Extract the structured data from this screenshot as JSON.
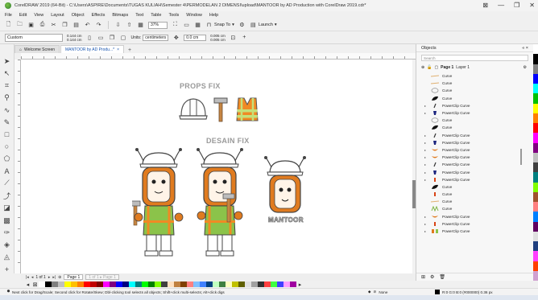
{
  "window": {
    "title": "CorelDRAW 2019 (64-Bit) - C:\\Users\\ASPIRE\\Documents\\TUGAS KULIAH\\Semester 4\\PERMODELAN 2 DIMENSI\\upload\\MANTOOR by AD Production with CorelDraw 2019.cdr*",
    "controls": [
      "⊠",
      "—",
      "❐",
      "✕"
    ]
  },
  "menu": [
    "File",
    "Edit",
    "View",
    "Layout",
    "Object",
    "Effects",
    "Bitmaps",
    "Text",
    "Table",
    "Tools",
    "Window",
    "Help"
  ],
  "toolbar": {
    "zoom": "37%",
    "snap_to": "Snap To",
    "launch": "Launch"
  },
  "property_bar": {
    "page_preset": "Custom",
    "width": "0.144 cm",
    "height": "0.144 cm",
    "units_label": "Units:",
    "units": "centimeters",
    "nudge": "0.0 cm",
    "dup_x": "0.005 cm",
    "dup_y": "0.005 cm"
  },
  "tabs": [
    {
      "label": "Welcome Screen",
      "active": false
    },
    {
      "label": "MANTOOR by AD Produ...*",
      "active": true
    }
  ],
  "canvas": {
    "props_heading": "PROPS FIX",
    "desain_heading": "DESAIN FIX",
    "mascot_label": "MANTOOR"
  },
  "page_navigator": {
    "counter": "1 of 1",
    "page": "Page 1",
    "ghost_page": "1 of 1 ▸ Page 1"
  },
  "status": {
    "hint": "Next click for Drag/Scale; Second click for Rotate/Skew; Dbl-clicking tool selects all objects; Shift+click multi-selects; Alt+click digs",
    "fill": "None",
    "fill_info": "R:0 G:0 B:0 (#000000) 0.36 px"
  },
  "docker": {
    "title": "Objects",
    "search_placeholder": "Search",
    "page_label": "Page 1",
    "layer_label": "Layer 1",
    "objects": [
      {
        "label": "Curve",
        "expandable": false,
        "thumb": "line"
      },
      {
        "label": "Curve",
        "expandable": false,
        "thumb": "line"
      },
      {
        "label": "Curve",
        "expandable": false,
        "thumb": "ring"
      },
      {
        "label": "Curve",
        "expandable": false,
        "thumb": "black"
      },
      {
        "label": "PowerClip Curve",
        "expandable": true,
        "thumb": "slash"
      },
      {
        "label": "PowerClip Curve",
        "expandable": true,
        "thumb": "navy"
      },
      {
        "label": "Curve",
        "expandable": false,
        "thumb": "ring"
      },
      {
        "label": "Curve",
        "expandable": false,
        "thumb": "black"
      },
      {
        "label": "PowerClip Curve",
        "expandable": true,
        "thumb": "slash"
      },
      {
        "label": "PowerClip Curve",
        "expandable": true,
        "thumb": "navy"
      },
      {
        "label": "PowerClip Curve",
        "expandable": true,
        "thumb": "orange"
      },
      {
        "label": "PowerClip Curve",
        "expandable": true,
        "thumb": "orange"
      },
      {
        "label": "PowerClip Curve",
        "expandable": true,
        "thumb": "slash"
      },
      {
        "label": "PowerClip Curve",
        "expandable": true,
        "thumb": "navy"
      },
      {
        "label": "PowerClip Curve",
        "expandable": true,
        "thumb": "red"
      },
      {
        "label": "Curve",
        "expandable": false,
        "thumb": "black"
      },
      {
        "label": "Curve",
        "expandable": false,
        "thumb": "red"
      },
      {
        "label": "Curve",
        "expandable": false,
        "thumb": "line"
      },
      {
        "label": "Curve",
        "expandable": false,
        "thumb": "green"
      },
      {
        "label": "PowerClip Curve",
        "expandable": true,
        "thumb": "orange"
      },
      {
        "label": "PowerClip Curve",
        "expandable": true,
        "thumb": "red"
      },
      {
        "label": "PowerClip Curve",
        "expandable": true,
        "thumb": "multi"
      }
    ]
  },
  "colors": {
    "accent": "#1a56b0",
    "orange": "#e07b1f",
    "vest_green": "#8bc34a",
    "vest_orange": "#f08a24"
  },
  "palette_colors": [
    "#ffffff",
    "#000000",
    "#808080",
    "#c0c0c0",
    "#ffff00",
    "#ffc000",
    "#ff8000",
    "#ff0000",
    "#c00000",
    "#800000",
    "#ff00ff",
    "#800080",
    "#0000ff",
    "#000080",
    "#00ffff",
    "#008080",
    "#00ff00",
    "#008000",
    "#80ff00",
    "#404040",
    "#ffe0c0",
    "#c08040",
    "#804000",
    "#ff8080",
    "#80c0ff",
    "#4080ff",
    "#004080",
    "#c0ffc0",
    "#408040",
    "#ffffc0",
    "#c0c000",
    "#606000",
    "#e0e0e0",
    "#a0a0a0",
    "#303030",
    "#ff4040",
    "#40ff40",
    "#4040ff",
    "#ffa0ff",
    "#a000a0"
  ],
  "right_palette": [
    "#ffffff",
    "#000000",
    "#808080",
    "#0000ff",
    "#00ffff",
    "#00c000",
    "#ffff00",
    "#ff8000",
    "#ff0000",
    "#ff00ff",
    "#800080",
    "#c0c0c0",
    "#404040",
    "#008080",
    "#80ff00",
    "#a0522d",
    "#ff8080",
    "#0080ff",
    "#600060",
    "#e0e0e0",
    "#204080",
    "#ff40ff",
    "#ff4000",
    "#d0a0d0"
  ]
}
